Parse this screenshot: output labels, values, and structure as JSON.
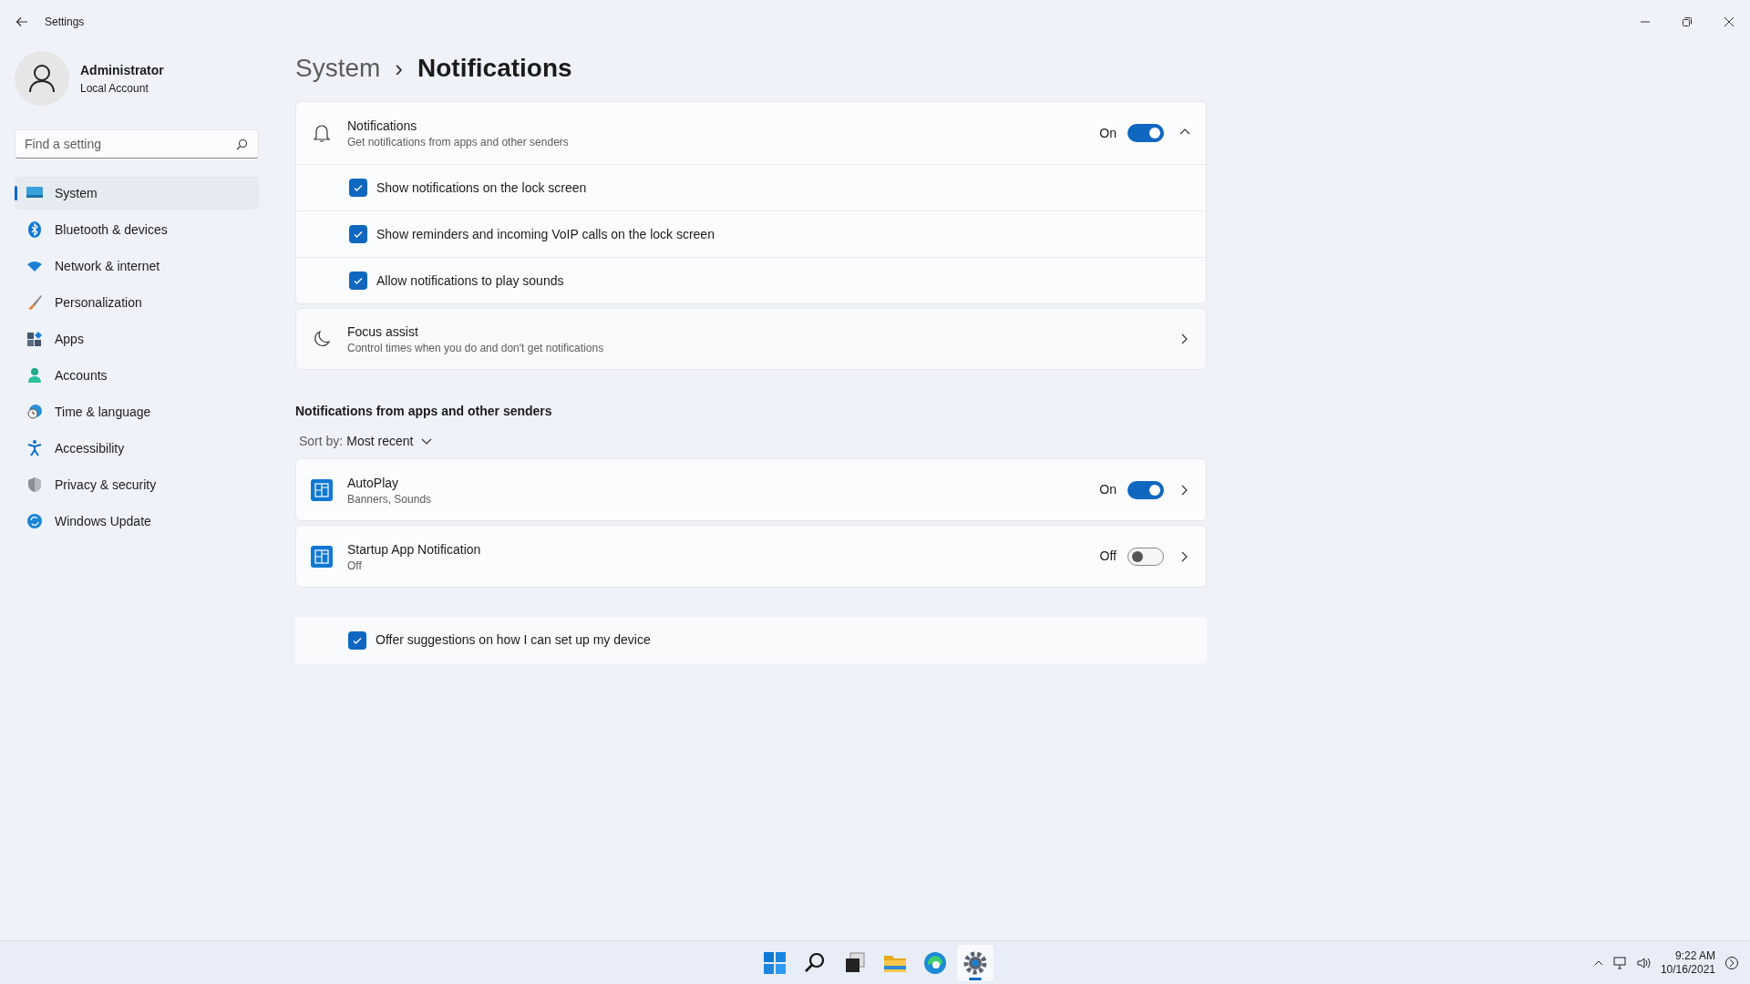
{
  "window": {
    "title": "Settings"
  },
  "account": {
    "name": "Administrator",
    "type": "Local Account"
  },
  "search": {
    "placeholder": "Find a setting"
  },
  "sidebar": {
    "items": [
      {
        "label": "System",
        "selected": true
      },
      {
        "label": "Bluetooth & devices",
        "selected": false
      },
      {
        "label": "Network & internet",
        "selected": false
      },
      {
        "label": "Personalization",
        "selected": false
      },
      {
        "label": "Apps",
        "selected": false
      },
      {
        "label": "Accounts",
        "selected": false
      },
      {
        "label": "Time & language",
        "selected": false
      },
      {
        "label": "Accessibility",
        "selected": false
      },
      {
        "label": "Privacy & security",
        "selected": false
      },
      {
        "label": "Windows Update",
        "selected": false
      }
    ]
  },
  "breadcrumb": {
    "parent": "System",
    "separator": "›",
    "current": "Notifications"
  },
  "notifications": {
    "title": "Notifications",
    "subtitle": "Get notifications from apps and other senders",
    "state_label": "On",
    "on": true,
    "expanded": true,
    "options": [
      {
        "label": "Show notifications on the lock screen",
        "checked": true
      },
      {
        "label": "Show reminders and incoming VoIP calls on the lock screen",
        "checked": true
      },
      {
        "label": "Allow notifications to play sounds",
        "checked": true
      }
    ]
  },
  "focus_assist": {
    "title": "Focus assist",
    "subtitle": "Control times when you do and don't get notifications"
  },
  "apps_section": {
    "heading": "Notifications from apps and other senders",
    "sort_label": "Sort by:",
    "sort_value": "Most recent",
    "apps": [
      {
        "name": "AutoPlay",
        "detail": "Banners, Sounds",
        "state_label": "On",
        "on": true
      },
      {
        "name": "Startup App Notification",
        "detail": "Off",
        "state_label": "Off",
        "on": false
      }
    ]
  },
  "suggestions": {
    "label": "Offer suggestions on how I can set up my device",
    "checked": true
  },
  "taskbar": {
    "apps": [
      {
        "selected": false
      },
      {
        "selected": false
      },
      {
        "selected": false
      },
      {
        "selected": false
      },
      {
        "selected": false
      },
      {
        "selected": true
      }
    ],
    "time": "9:22 AM",
    "date": "10/16/2021"
  }
}
